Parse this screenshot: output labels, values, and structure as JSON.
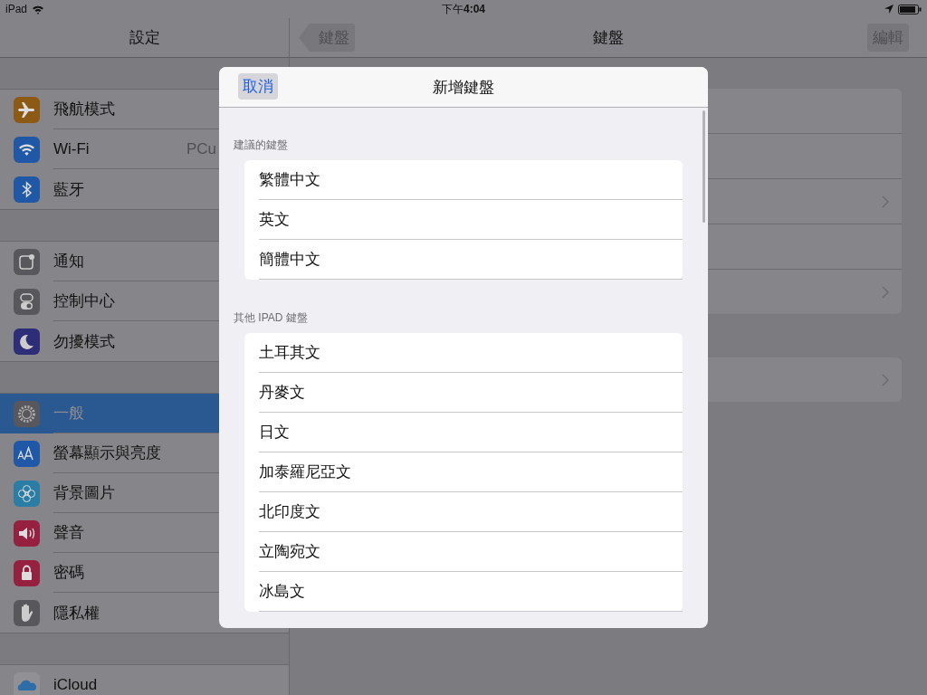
{
  "status_bar": {
    "device": "iPad",
    "time": "下午**4:04**"
  },
  "sidebar": {
    "title": "設定",
    "groups": [
      [
        {
          "label": "飛航模式",
          "kind": "airplane",
          "color": "#8c5a12",
          "selected": false
        },
        {
          "label": "Wi-Fi",
          "value": "PCu",
          "kind": "wifi",
          "color": "#1e58a6",
          "selected": false
        },
        {
          "label": "藍牙",
          "kind": "bluetooth",
          "color": "#1e58a6",
          "selected": false
        }
      ],
      [
        {
          "label": "通知",
          "kind": "notification",
          "color": "#58585c",
          "selected": false
        },
        {
          "label": "控制中心",
          "kind": "switches",
          "color": "#58585c",
          "selected": false
        },
        {
          "label": "勿擾模式",
          "kind": "moon",
          "color": "#2e2e78",
          "selected": false
        }
      ],
      [
        {
          "label": "一般",
          "kind": "gear",
          "color": "#58585c",
          "selected": true
        },
        {
          "label": "螢幕顯示與亮度",
          "kind": "text-size",
          "color": "#1e58a6",
          "selected": false
        },
        {
          "label": "背景圖片",
          "kind": "flower",
          "color": "#2a7ea6",
          "selected": false
        },
        {
          "label": "聲音",
          "kind": "speaker",
          "color": "#962040",
          "selected": false
        },
        {
          "label": "密碼",
          "kind": "lock",
          "color": "#962040",
          "selected": false
        },
        {
          "label": "隱私權",
          "kind": "hand",
          "color": "#58585c",
          "selected": false
        }
      ],
      [
        {
          "label": "iCloud",
          "kind": "cloud",
          "color": "#919195",
          "selected": false
        }
      ]
    ]
  },
  "detail": {
    "back": "鍵盤",
    "title": "鍵盤",
    "edit": "編輯",
    "cards": [
      {
        "rows": [
          {
            "chevron": false
          },
          {
            "chevron": false
          },
          {
            "chevron": true
          },
          {
            "chevron": false
          },
          {
            "chevron": true
          }
        ]
      },
      {
        "rows": [
          {
            "chevron": true
          }
        ]
      }
    ]
  },
  "modal": {
    "cancel": "取消",
    "title": "新增鍵盤",
    "sections": [
      {
        "header": "建議的鍵盤",
        "items": [
          "繁體中文",
          "英文",
          "簡體中文"
        ]
      },
      {
        "header": "其他 IPAD 鍵盤",
        "items": [
          "土耳其文",
          "丹麥文",
          "日文",
          "加泰羅尼亞文",
          "北印度文",
          "立陶宛文",
          "冰島文"
        ]
      }
    ]
  }
}
